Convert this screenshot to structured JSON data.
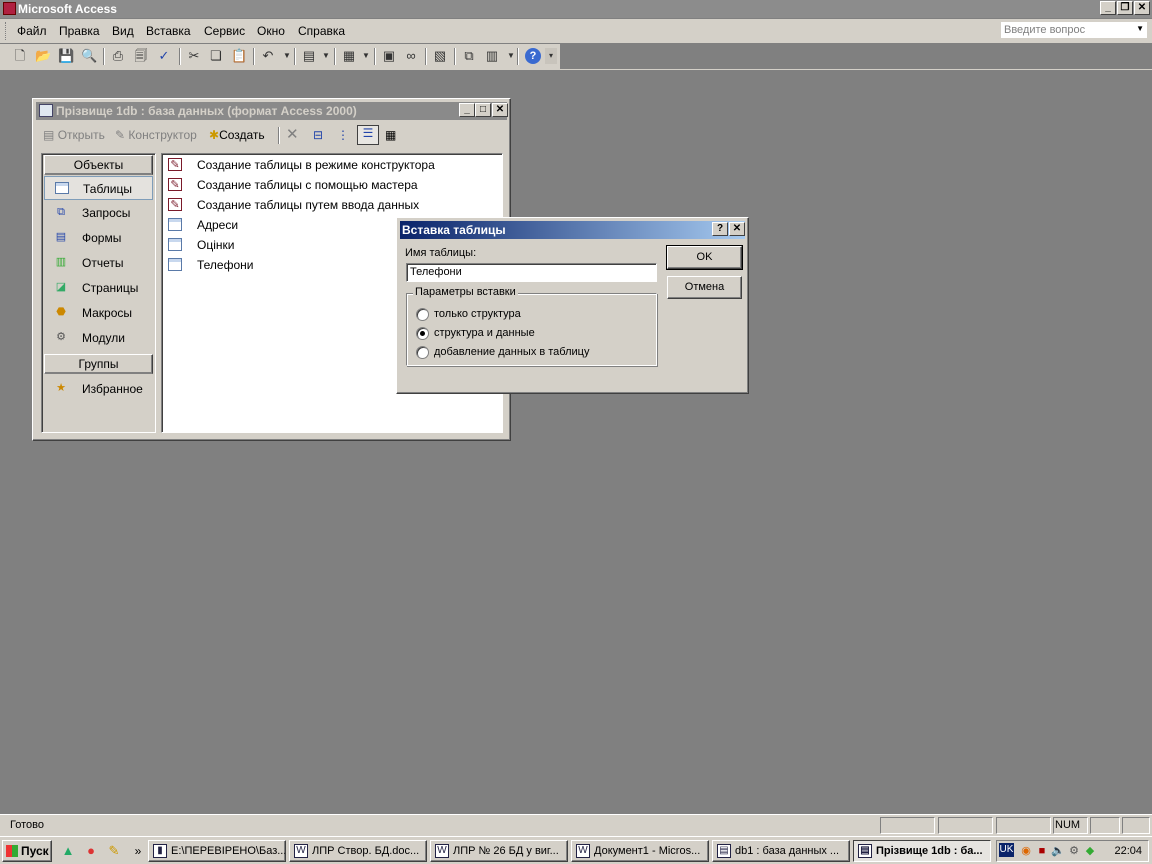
{
  "app": {
    "title": "Microsoft Access"
  },
  "menu": {
    "items": [
      "Файл",
      "Правка",
      "Вид",
      "Вставка",
      "Сервис",
      "Окно",
      "Справка"
    ],
    "ask_placeholder": "Введите вопрос"
  },
  "toolbar": {
    "icons": [
      "new-icon",
      "open-icon",
      "save-icon",
      "search-file-icon",
      "print-icon",
      "print-preview-icon",
      "spelling-icon",
      "cut-icon",
      "copy-icon",
      "paste-icon",
      "undo-icon",
      "office-links-icon",
      "analyze-icon",
      "properties-icon",
      "relationships-icon",
      "new-object-icon",
      "help-icon"
    ]
  },
  "db_window": {
    "title": "Прізвище 1db : база данных (формат Access 2000)",
    "toolbar": {
      "open": "Открыть",
      "design": "Конструктор",
      "new": "Создать"
    },
    "objects_header": "Объекты",
    "objects": [
      {
        "label": "Таблицы",
        "icon": "table-icon",
        "selected": true
      },
      {
        "label": "Запросы",
        "icon": "query-icon"
      },
      {
        "label": "Формы",
        "icon": "form-icon"
      },
      {
        "label": "Отчеты",
        "icon": "report-icon"
      },
      {
        "label": "Страницы",
        "icon": "page-icon"
      },
      {
        "label": "Макросы",
        "icon": "macro-icon"
      },
      {
        "label": "Модули",
        "icon": "module-icon"
      }
    ],
    "groups_header": "Группы",
    "groups": [
      {
        "label": "Избранное",
        "icon": "favorites-icon"
      }
    ],
    "list": [
      {
        "label": "Создание таблицы в режиме конструктора",
        "icon": "wizard-icon"
      },
      {
        "label": "Создание таблицы с помощью мастера",
        "icon": "wizard-icon"
      },
      {
        "label": "Создание таблицы путем ввода данных",
        "icon": "wizard-icon"
      },
      {
        "label": "Адреси",
        "icon": "table-icon"
      },
      {
        "label": "Оцінки",
        "icon": "table-icon"
      },
      {
        "label": "Телефони",
        "icon": "table-icon"
      }
    ]
  },
  "dialog": {
    "title": "Вставка таблицы",
    "help": "?",
    "name_label": "Имя таблицы:",
    "name_value": "Телефони",
    "ok": "OK",
    "cancel": "Отмена",
    "group_caption": "Параметры вставки",
    "options": [
      {
        "label": "только структура",
        "checked": false
      },
      {
        "label": "структура и данные",
        "checked": true
      },
      {
        "label": "добавление данных в таблицу",
        "checked": false
      }
    ]
  },
  "statusbar": {
    "text": "Готово",
    "num": "NUM"
  },
  "taskbar": {
    "start": "Пуск",
    "tasks": [
      {
        "label": "E:\\ПЕРЕВІРЕНО\\Баз...",
        "active": false
      },
      {
        "label": "ЛПР Створ. БД.doc...",
        "active": false
      },
      {
        "label": "ЛПР № 26 БД у виг...",
        "active": false
      },
      {
        "label": "Документ1 - Micros...",
        "active": false
      },
      {
        "label": "db1 : база данных ...",
        "active": false
      },
      {
        "label": "Прізвище 1db : ба...",
        "active": true
      }
    ],
    "lang": "UK",
    "clock": "22:04"
  }
}
